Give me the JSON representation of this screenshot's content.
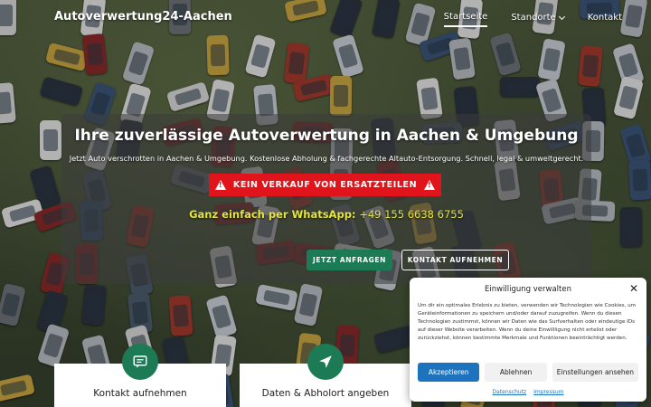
{
  "header": {
    "logo": "Autoverwertung24-Aachen",
    "nav": [
      {
        "label": "Startseite",
        "active": true
      },
      {
        "label": "Standorte",
        "has_dropdown": true
      },
      {
        "label": "Kontakt"
      }
    ]
  },
  "hero": {
    "title": "Ihre zuverlässige Autoverwertung in Aachen & Umgebung",
    "subtitle": "Jetzt Auto verschrotten in Aachen & Umgebung. Kostenlose Abholung & fachgerechte Altauto-Entsorgung. Schnell, legal & umweltgerecht.",
    "warning": "KEIN VERKAUF VON ERSATZTEILEN",
    "whatsapp_label": "Ganz einfach per WhatsApp:",
    "whatsapp_number": "+49 155 6638 6755",
    "primary_button": "JETZT ANFRAGEN",
    "secondary_button": "KONTAKT AUFNEHMEN"
  },
  "cards": [
    {
      "label": "Kontakt aufnehmen",
      "icon": "message-icon"
    },
    {
      "label": "Daten & Abholort angeben",
      "icon": "navigation-arrow-icon"
    }
  ],
  "cookie": {
    "title": "Einwilligung verwalten",
    "text": "Um dir ein optimales Erlebnis zu bieten, verwenden wir Technologien wie Cookies, um Geräteinformationen zu speichern und/oder darauf zuzugreifen. Wenn du diesen Technologien zustimmst, können wir Daten wie das Surfverhalten oder eindeutige IDs auf dieser Website verarbeiten. Wenn du deine Einwillligung nicht erteilst oder zurückziehst, können bestimmte Merkmale und Funktionen beeinträchtigt werden.",
    "accept": "Akzeptieren",
    "deny": "Ablehnen",
    "settings": "Einstellungen ansehen",
    "link_privacy": "Datenschutz",
    "link_imprint": "Impressum"
  },
  "colors": {
    "accent_green": "#1c7a55",
    "warning_red": "#e1131b",
    "whatsapp_yellow": "#e4e63a",
    "cookie_blue": "#1e73be"
  }
}
